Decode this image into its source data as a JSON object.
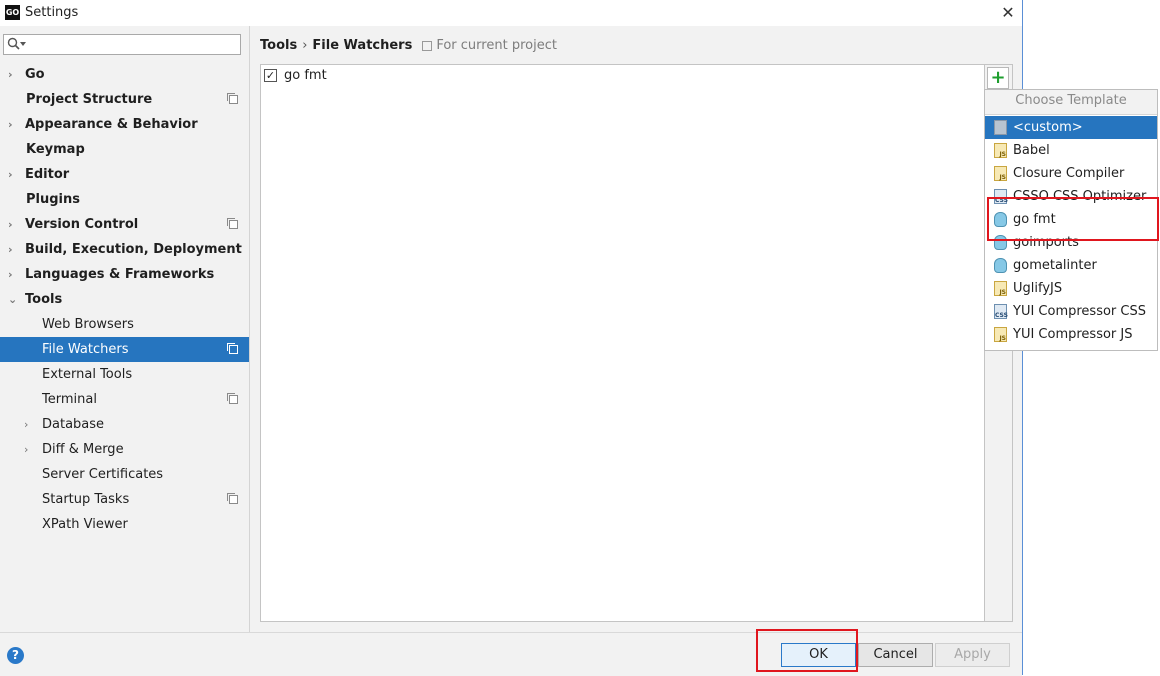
{
  "window": {
    "title": "Settings",
    "app_icon_text": "GO",
    "close": "✕"
  },
  "sidebar": {
    "search": {
      "value": "",
      "placeholder": ""
    },
    "items": [
      {
        "label": "Go",
        "bold": true,
        "arrow": "›",
        "project": false
      },
      {
        "label": "Project Structure",
        "bold": true,
        "arrow": "",
        "project": true
      },
      {
        "label": "Appearance & Behavior",
        "bold": true,
        "arrow": "›",
        "project": false
      },
      {
        "label": "Keymap",
        "bold": true,
        "arrow": "",
        "project": false
      },
      {
        "label": "Editor",
        "bold": true,
        "arrow": "›",
        "project": false
      },
      {
        "label": "Plugins",
        "bold": true,
        "arrow": "",
        "project": false
      },
      {
        "label": "Version Control",
        "bold": true,
        "arrow": "›",
        "project": true
      },
      {
        "label": "Build, Execution, Deployment",
        "bold": true,
        "arrow": "›",
        "project": false
      },
      {
        "label": "Languages & Frameworks",
        "bold": true,
        "arrow": "›",
        "project": false
      },
      {
        "label": "Tools",
        "bold": true,
        "arrow": "⌄",
        "project": false
      },
      {
        "label": "Web Browsers",
        "bold": false,
        "arrow": "",
        "project": false
      },
      {
        "label": "File Watchers",
        "bold": false,
        "arrow": "",
        "project": true,
        "selected": true
      },
      {
        "label": "External Tools",
        "bold": false,
        "arrow": "",
        "project": false
      },
      {
        "label": "Terminal",
        "bold": false,
        "arrow": "",
        "project": true
      },
      {
        "label": "Database",
        "bold": false,
        "arrow": "›",
        "project": false
      },
      {
        "label": "Diff & Merge",
        "bold": false,
        "arrow": "›",
        "project": false
      },
      {
        "label": "Server Certificates",
        "bold": false,
        "arrow": "",
        "project": false
      },
      {
        "label": "Startup Tasks",
        "bold": false,
        "arrow": "",
        "project": true
      },
      {
        "label": "XPath Viewer",
        "bold": false,
        "arrow": "",
        "project": false
      }
    ]
  },
  "main": {
    "breadcrumb": {
      "parent": "Tools",
      "separator": "›",
      "current": "File Watchers",
      "scope": "For current project"
    },
    "watchers": [
      {
        "label": "go fmt",
        "checked": true,
        "check_glyph": "✓"
      }
    ],
    "add_button": "+"
  },
  "popup": {
    "title": "Choose Template",
    "items": [
      {
        "label": "<custom>",
        "icon": "custom-icon",
        "selected": true
      },
      {
        "label": "Babel",
        "icon": "js-file-icon"
      },
      {
        "label": "Closure Compiler",
        "icon": "js-file-icon"
      },
      {
        "label": "CSSO CSS Optimizer",
        "icon": "css-file-icon"
      },
      {
        "label": "go fmt",
        "icon": "gopher-icon"
      },
      {
        "label": "goimports",
        "icon": "gopher-icon"
      },
      {
        "label": "gometalinter",
        "icon": "gopher-icon"
      },
      {
        "label": "UglifyJS",
        "icon": "js-file-icon"
      },
      {
        "label": "YUI Compressor CSS",
        "icon": "css-file-icon"
      },
      {
        "label": "YUI Compressor JS",
        "icon": "js-file-icon"
      }
    ]
  },
  "footer": {
    "help": "?",
    "ok": "OK",
    "cancel": "Cancel",
    "apply": "Apply"
  },
  "colors": {
    "accent": "#2675bf",
    "highlight_box": "#e0161e",
    "add_green": "#1e9e2e"
  }
}
